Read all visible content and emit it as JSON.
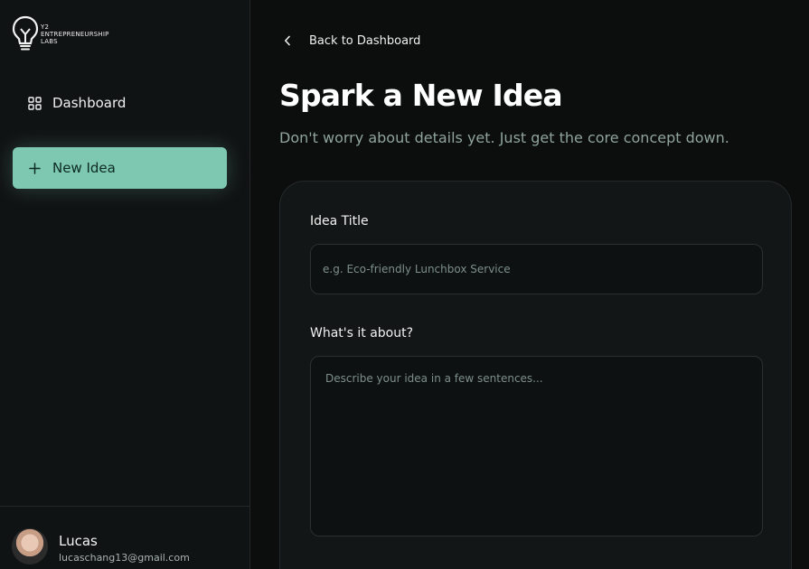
{
  "brand": {
    "line1": "Y2",
    "line2": "Entrepreneurship",
    "line3": "Labs",
    "icon": "lightbulb-icon"
  },
  "sidebar": {
    "items": [
      {
        "label": "Dashboard",
        "icon": "grid-icon",
        "active": false
      },
      {
        "label": "New Idea",
        "icon": "plus-icon",
        "active": true
      }
    ],
    "accent_color": "#7ec8b1"
  },
  "user": {
    "name": "Lucas",
    "email": "lucaschang13@gmail.com"
  },
  "main": {
    "back_label": "Back to Dashboard",
    "title": "Spark a New Idea",
    "subtitle": "Don't worry about details yet. Just get the core concept down.",
    "form": {
      "title_label": "Idea Title",
      "title_placeholder": "e.g. Eco-friendly Lunchbox Service",
      "title_value": "",
      "about_label": "What's it about?",
      "about_placeholder": "Describe your idea in a few sentences...",
      "about_value": ""
    }
  }
}
